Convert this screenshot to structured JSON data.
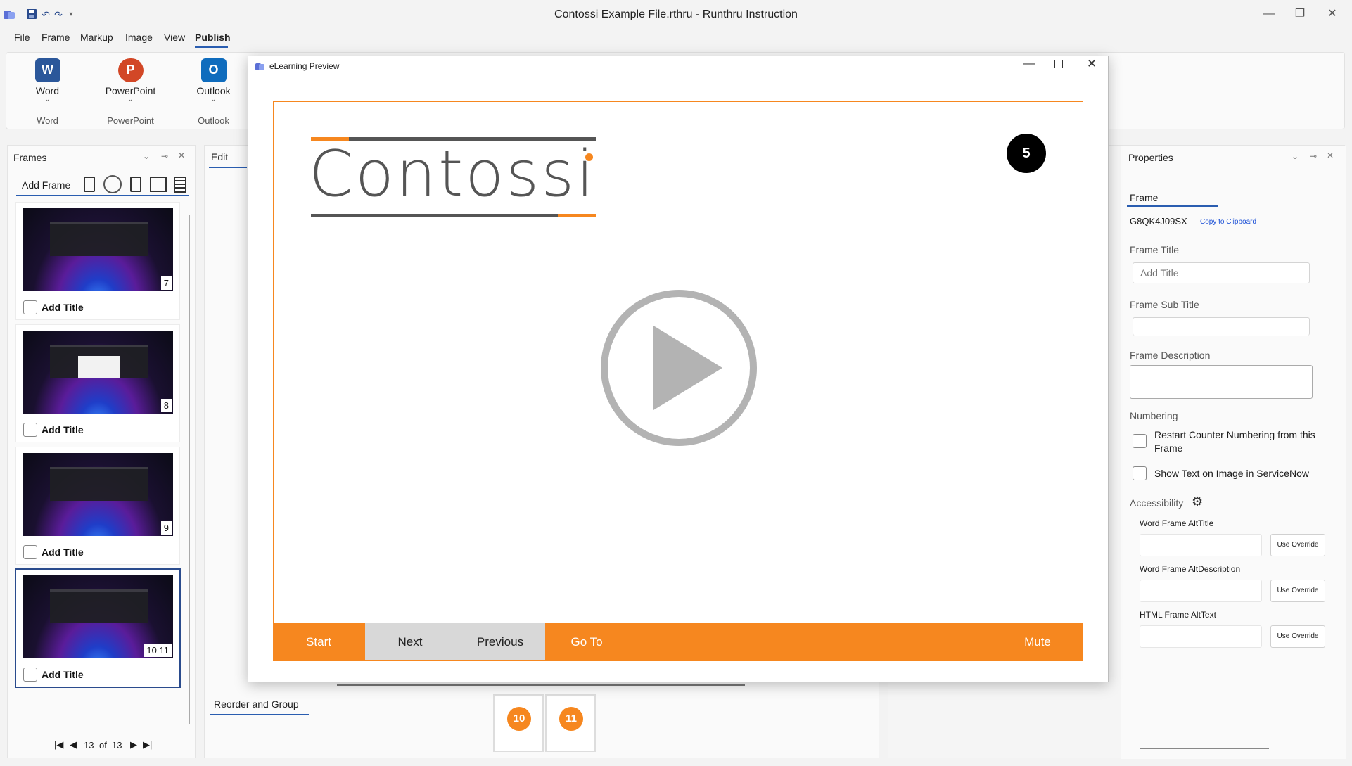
{
  "window": {
    "title": "Contossi Example File.rthru - Runthru Instruction",
    "controls": {
      "minimize": "—",
      "restore": "❐",
      "close": "✕"
    }
  },
  "menu": [
    "File",
    "Frame",
    "Markup",
    "Image",
    "View",
    "Publish"
  ],
  "ribbon": {
    "groups": [
      {
        "button": "Word",
        "label": "Word",
        "icon_letter": "W",
        "color": "#2b579a"
      },
      {
        "button": "PowerPoint",
        "label": "PowerPoint",
        "icon_letter": "P",
        "color": "#d24726"
      },
      {
        "button": "Outlook",
        "label": "Outlook",
        "icon_letter": "O",
        "color": "#0f6cbd"
      }
    ]
  },
  "frames_panel": {
    "title": "Frames",
    "add_frame": "Add Frame",
    "cards": [
      {
        "number": "7",
        "title": "Add Title"
      },
      {
        "number": "8",
        "title": "Add Title"
      },
      {
        "number": "9",
        "title": "Add Title"
      },
      {
        "number": "10 11",
        "title": "Add Title"
      }
    ],
    "pager": {
      "current": "13",
      "of": "of",
      "total": "13"
    }
  },
  "edit_panel": {
    "tab": "Edit",
    "reorder_tab": "Reorder and Group",
    "group_badges": [
      "10",
      "11"
    ]
  },
  "preview": {
    "title": "eLearning Preview",
    "logo_text": "Contossi",
    "step_badge": "5",
    "nav": {
      "start": "Start",
      "next": "Next",
      "previous": "Previous",
      "goto": "Go To",
      "mute": "Mute"
    },
    "accent": "#f6871f"
  },
  "properties": {
    "title": "Properties",
    "tab": "Frame",
    "frame_id": "G8QK4J09SX",
    "copy_link": "Copy to Clipboard",
    "frame_title_label": "Frame Title",
    "frame_title_placeholder": "Add Title",
    "frame_subtitle_label": "Frame Sub Title",
    "frame_description_label": "Frame Description",
    "numbering_label": "Numbering",
    "restart_counter": "Restart Counter Numbering from this Frame",
    "show_text": "Show Text on Image in ServiceNow",
    "accessibility_label": "Accessibility",
    "word_alt_title": "Word Frame AltTitle",
    "word_alt_desc": "Word Frame AltDescription",
    "html_alt_text": "HTML Frame AltText",
    "use_override": "Use Override"
  }
}
